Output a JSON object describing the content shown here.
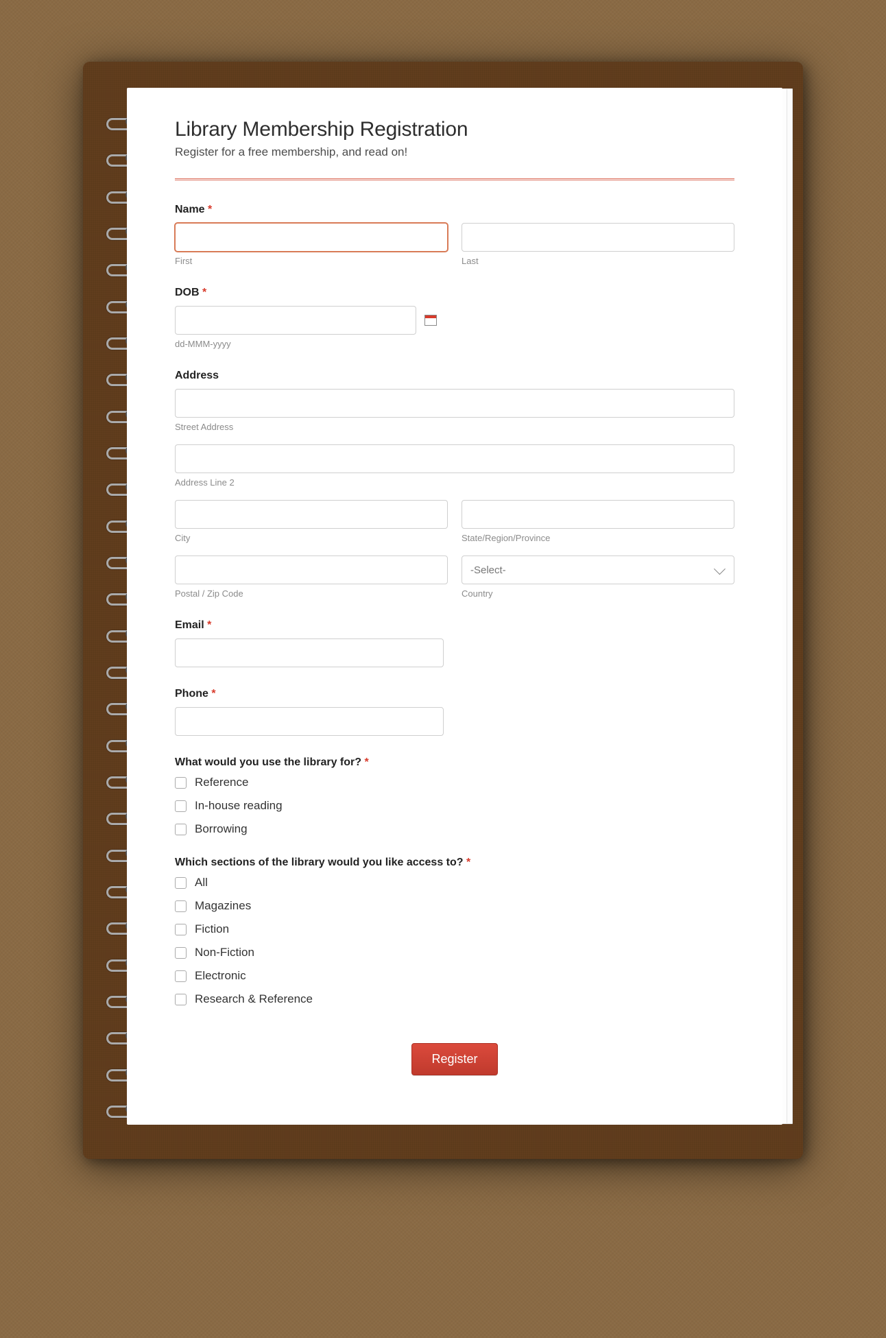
{
  "header": {
    "title": "Library Membership Registration",
    "subtitle": "Register for a free membership, and read on!"
  },
  "name": {
    "label": "Name",
    "required": "*",
    "first_sub": "First",
    "last_sub": "Last"
  },
  "dob": {
    "label": "DOB",
    "required": "*",
    "format": "dd-MMM-yyyy"
  },
  "address": {
    "label": "Address",
    "street_sub": "Street Address",
    "line2_sub": "Address Line 2",
    "city_sub": "City",
    "state_sub": "State/Region/Province",
    "postal_sub": "Postal / Zip Code",
    "country_sub": "Country",
    "country_placeholder": "-Select-"
  },
  "email": {
    "label": "Email",
    "required": "*"
  },
  "phone": {
    "label": "Phone",
    "required": "*"
  },
  "usage": {
    "label": "What would you use the library for?",
    "required": "*",
    "options": [
      "Reference",
      "In-house reading",
      "Borrowing"
    ]
  },
  "sections": {
    "label": "Which sections of the library would you like access to?",
    "required": "*",
    "options": [
      "All",
      "Magazines",
      "Fiction",
      "Non-Fiction",
      "Electronic",
      "Research & Reference"
    ]
  },
  "submit": {
    "label": "Register"
  }
}
